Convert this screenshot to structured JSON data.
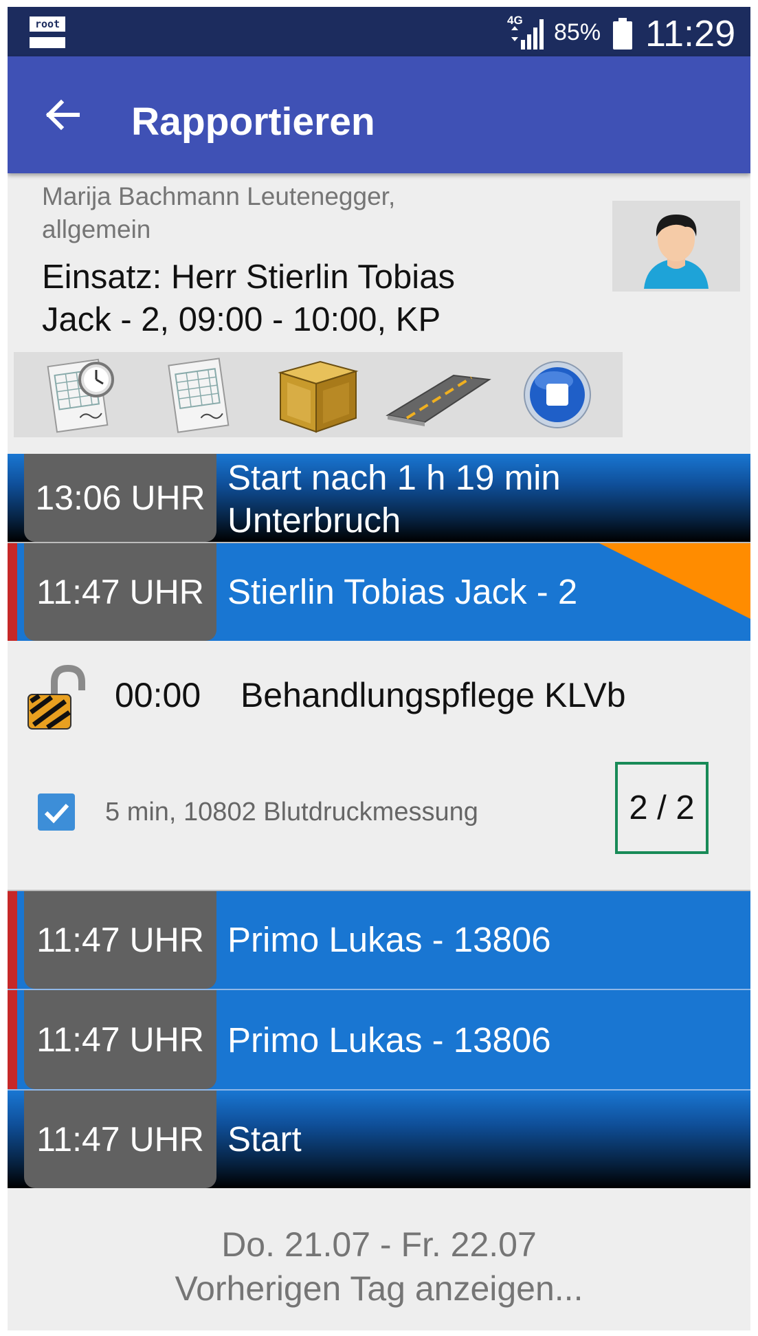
{
  "status_bar": {
    "root_label": "root",
    "network": "4G",
    "battery_percent": "85%",
    "time": "11:29",
    "icons": [
      "root-badge-icon",
      "signal-icon",
      "battery-icon"
    ]
  },
  "app_bar": {
    "back_icon": "arrow-left-icon",
    "title": "Rapportieren"
  },
  "header": {
    "employee": "Marija  Bachmann Leutenegger, allgemein",
    "assignment": "Einsatz: Herr Stierlin Tobias Jack - 2, 09:00 - 10:00, KP",
    "avatar_icon": "user-avatar-icon"
  },
  "toolbar": {
    "buttons": [
      {
        "icon": "timesheet-clock-icon"
      },
      {
        "icon": "timesheet-icon"
      },
      {
        "icon": "material-crate-icon"
      },
      {
        "icon": "road-travel-icon"
      },
      {
        "icon": "stop-circle-icon"
      }
    ]
  },
  "entries": [
    {
      "time": "13:06 UHR",
      "text": "Start nach 1 h 19 min Unterbruch",
      "style": "dark",
      "marker": ""
    },
    {
      "time": "11:47 UHR",
      "text": "Stierlin Tobias Jack - 2",
      "style": "blue",
      "marker": "red",
      "corner_color": "#ff8c00"
    },
    {
      "time": "11:47 UHR",
      "text": "Primo Lukas - 13806",
      "style": "blue",
      "marker": "red"
    },
    {
      "time": "11:47 UHR",
      "text": "Primo Lukas - 13806",
      "style": "blue",
      "marker": "red"
    },
    {
      "time": "11:47 UHR",
      "text": "Start",
      "style": "dark",
      "marker": ""
    }
  ],
  "service_detail": {
    "lock_icon": "unlocked-padlock-icon",
    "duration": "00:00",
    "title": "Behandlungspflege KLVb",
    "subitem": {
      "checked": true,
      "text": "5 min, 10802 Blutdruckmessung",
      "count": "2 / 2"
    }
  },
  "footer": {
    "date_range": "Do. 21.07 - Fr. 22.07",
    "previous_day": "Vorherigen Tag anzeigen..."
  },
  "colors": {
    "app_bar": "#3f51b5",
    "status_bar": "#1c2c5e",
    "entry_blue": "#1976d2",
    "time_box": "#616161",
    "marker_red": "#c62828",
    "count_border": "#188a57",
    "checkbox": "#3d8ed8"
  }
}
